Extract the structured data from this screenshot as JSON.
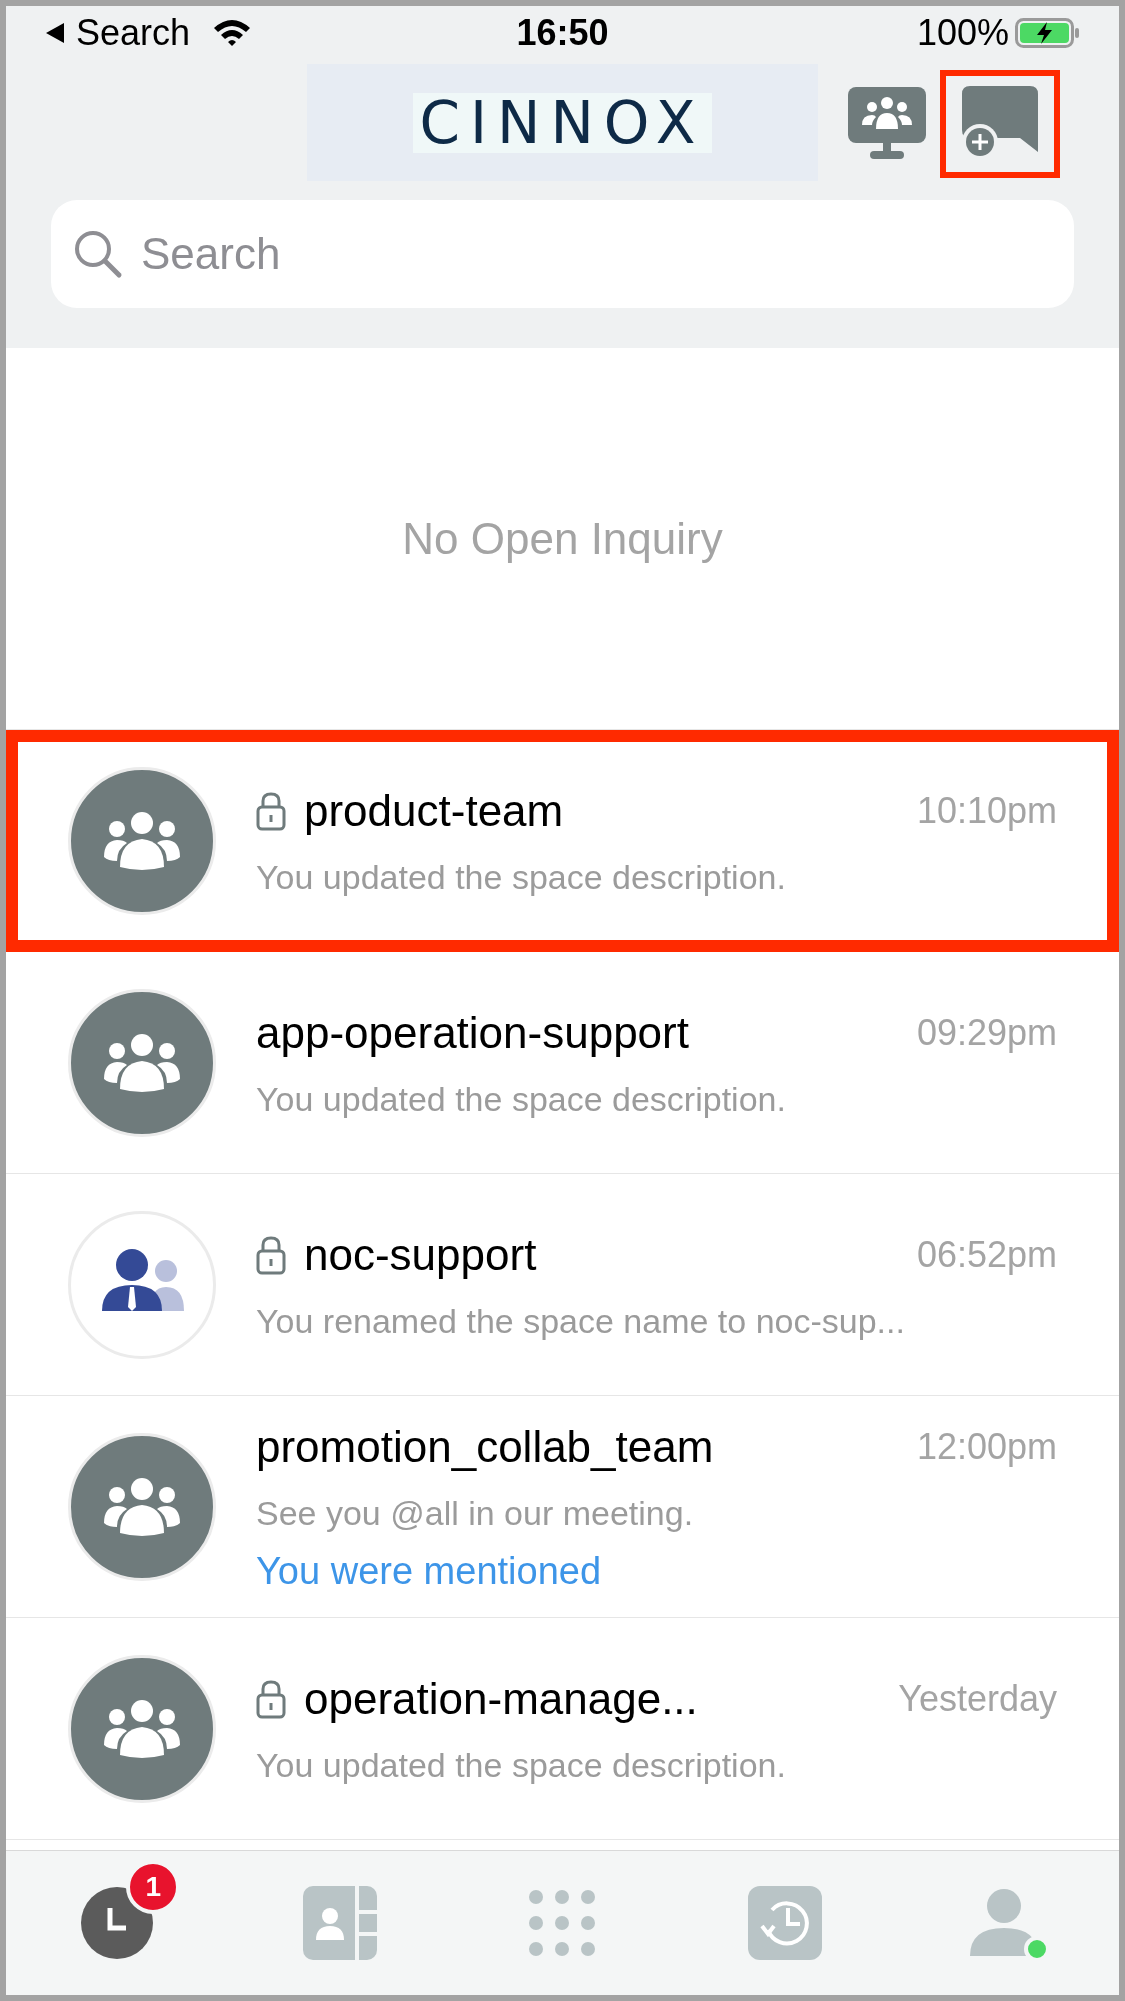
{
  "status_bar": {
    "back_label": "Search",
    "time": "16:50",
    "battery": "100%"
  },
  "header": {
    "logo": "CINNOX",
    "actions": [
      {
        "kind": "meeting",
        "highlighted": false
      },
      {
        "kind": "new-chat",
        "highlighted": true
      }
    ]
  },
  "search": {
    "placeholder": "Search"
  },
  "inquiries": {
    "empty_text": "No Open Inquiry"
  },
  "conversations": [
    {
      "title": "product-team",
      "time": "10:10pm",
      "preview": "You updated the space description.",
      "locked": true,
      "kind": "group",
      "highlighted": true
    },
    {
      "title": "app-operation-support",
      "time": "09:29pm",
      "preview": "You updated the space description.",
      "locked": false,
      "kind": "group",
      "highlighted": false
    },
    {
      "title": "noc-support",
      "time": "06:52pm",
      "preview": "You renamed the space name to noc-sup...",
      "locked": true,
      "kind": "people",
      "highlighted": false
    },
    {
      "title": "promotion_collab_team",
      "time": "12:00pm",
      "preview": "See you @all in our meeting.",
      "mention": "You were mentioned",
      "locked": false,
      "kind": "group",
      "highlighted": false
    },
    {
      "title": "operation-manage...",
      "time": "Yesterday",
      "preview": "You updated the space description.",
      "locked": true,
      "kind": "group",
      "highlighted": false
    }
  ],
  "tab_bar": [
    {
      "kind": "chats",
      "selected": true,
      "badge": "1"
    },
    {
      "kind": "contacts",
      "selected": false
    },
    {
      "kind": "keypad",
      "selected": false
    },
    {
      "kind": "history",
      "selected": false
    },
    {
      "kind": "profile",
      "selected": false,
      "online": true
    }
  ]
}
